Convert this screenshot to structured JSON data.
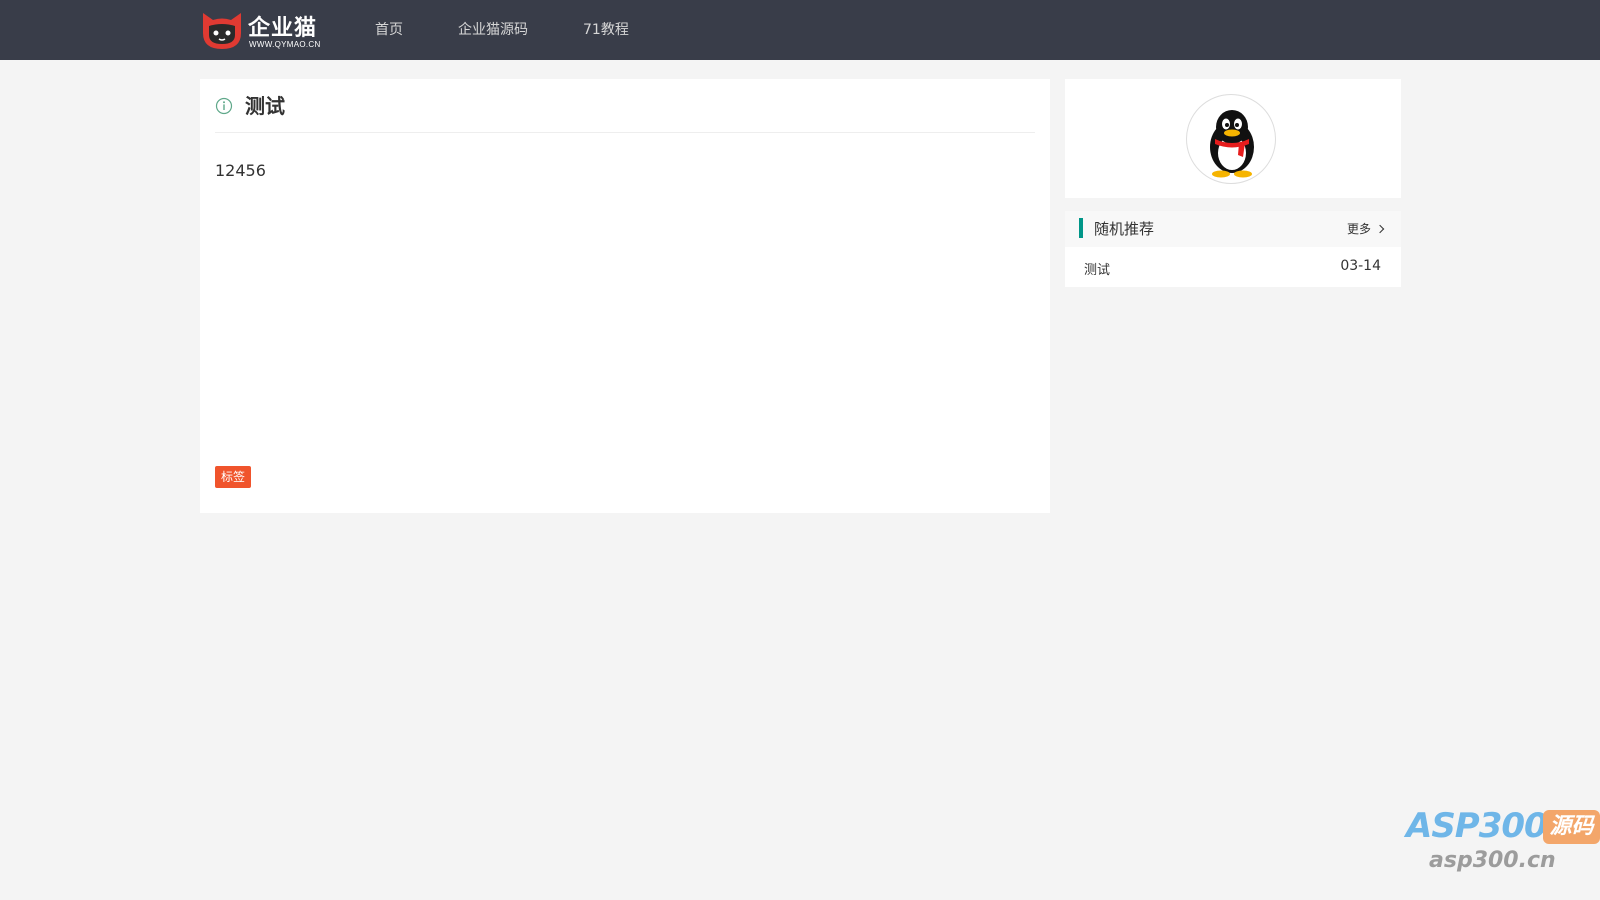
{
  "header": {
    "logo_name": "企业猫",
    "logo_url": "WWW.QYMAO.CN",
    "nav": [
      "首页",
      "企业猫源码",
      "71教程"
    ]
  },
  "article": {
    "title": "测试",
    "body": "12456",
    "tag": "标签"
  },
  "sidebar": {
    "recommend_title": "随机推荐",
    "more_label": "更多",
    "items": [
      {
        "title": "测试",
        "date": "03-14"
      }
    ]
  },
  "watermark": {
    "brand": "ASP300",
    "badge": "源码",
    "url": "asp300.cn"
  },
  "colors": {
    "header_bg": "#393d49",
    "accent_teal": "#009688",
    "tag_orange": "#f0542c",
    "logo_red": "#e03a32"
  },
  "icons": [
    "cat-logo-icon",
    "info-icon",
    "chevron-right-icon",
    "qq-penguin-avatar"
  ]
}
